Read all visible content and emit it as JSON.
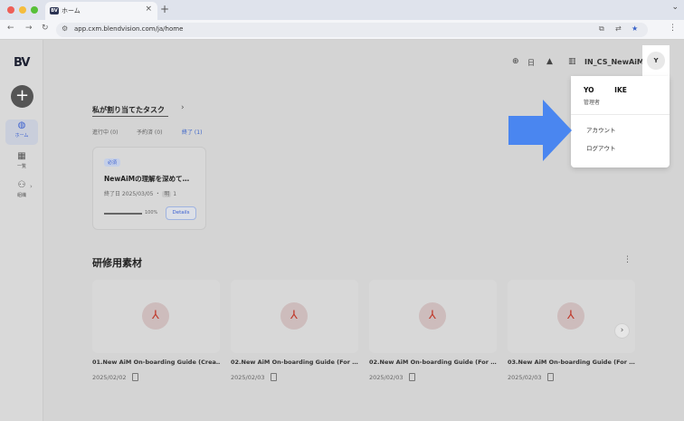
{
  "browser": {
    "tab_favicon": "BV",
    "tab_title": "ホーム",
    "tab_close": "×",
    "new_tab": "+",
    "tab_menu": "⌄",
    "url": "app.cxm.blendvision.com/ja/home",
    "traffic_colors": [
      "#ee5f57",
      "#f5bd3e",
      "#57c038"
    ]
  },
  "sidebar": {
    "logo": "BV",
    "create_button": "+",
    "items": [
      {
        "icon": "home-icon",
        "label": "ホーム",
        "active": true
      },
      {
        "icon": "grid-icon",
        "label": "一覧",
        "active": false
      },
      {
        "icon": "users-icon",
        "label": "組織",
        "active": false
      }
    ]
  },
  "header": {
    "language": "日",
    "org_name": "IN_CS_NewAiM",
    "avatar_initial": "Y"
  },
  "tasks": {
    "title": "私が割り当てたタスク",
    "filters": [
      {
        "label": "進行中 (0)",
        "active": false
      },
      {
        "label": "予約済 (0)",
        "active": false
      },
      {
        "label": "終了 (1)",
        "active": true
      }
    ],
    "card": {
      "badge": "必須",
      "title": "NewAiMの理解を深めて…",
      "due": "終了日 2025/03/05",
      "assignee_badge": "明",
      "assignee_count": "1",
      "progress": 100,
      "progress_label": "100%",
      "details_label": "Details"
    }
  },
  "materials": {
    "title": "研修用素材",
    "items": [
      {
        "title": "01.New AiM On-boarding Guide (Crea…",
        "date": "2025/02/02"
      },
      {
        "title": "02.New AiM On-boarding Guide (For …",
        "date": "2025/02/03"
      },
      {
        "title": "02.New AiM On-boarding Guide (For …",
        "date": "2025/02/03"
      },
      {
        "title": "03.New AiM On-boarding Guide (For …",
        "date": "2025/02/03"
      }
    ]
  },
  "user_menu": {
    "name": "YO IKE",
    "role": "管理者",
    "items": [
      "アカウント",
      "ログアウト"
    ]
  },
  "colors": {
    "accent": "#3a63c9",
    "arrow": "#4a86f0"
  }
}
